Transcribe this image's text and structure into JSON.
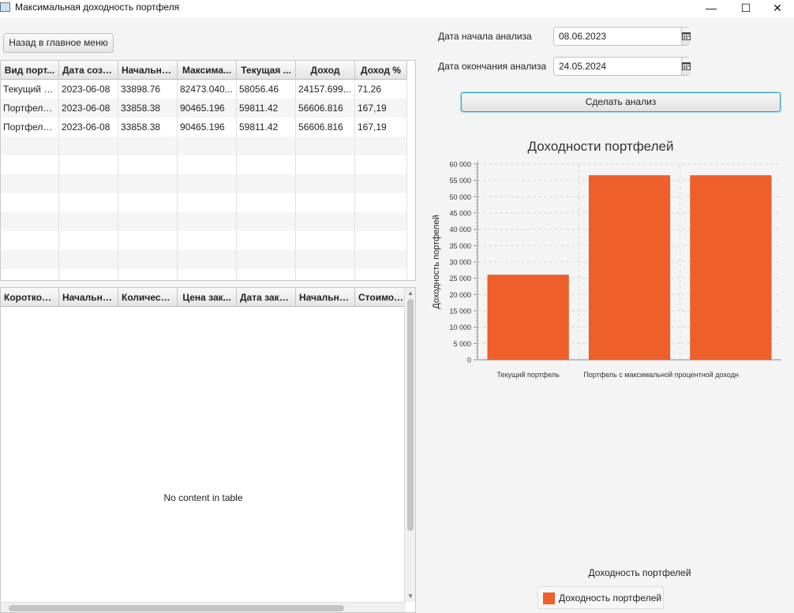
{
  "window": {
    "title": "Максимальная доходность портфеля",
    "minimize_label": "—",
    "maximize_label": "☐",
    "close_label": "✕"
  },
  "back_button_label": "Назад в главное меню",
  "portfolio_table": {
    "columns": [
      "Вид порт...",
      "Дата созд...",
      "Начально...",
      "Максима...",
      "Текущая ...",
      "Доход",
      "Доход %"
    ],
    "rows": [
      [
        "Текущий п...",
        "2023-06-08",
        "33898.76",
        "82473.040...",
        "58056.46",
        "24157.699...",
        "71,26"
      ],
      [
        "Портфель ...",
        "2023-06-08",
        "33858.38",
        "90465.196",
        "59811.42",
        "56606.816",
        "167,19"
      ],
      [
        "Портфель ...",
        "2023-06-08",
        "33858.38",
        "90465.196",
        "59811.42",
        "56606.816",
        "167,19"
      ]
    ]
  },
  "positions_table": {
    "columns": [
      "Короткое ...",
      "Начальна...",
      "Количество",
      "Цена зак...",
      "Дата закр...",
      "Начальна...",
      "Стоимост..."
    ],
    "empty_text": "No content in table"
  },
  "analysis": {
    "start_label": "Дата начала анализа",
    "start_value": "08.06.2023",
    "end_label": "Дата окончания анализа",
    "end_value": "24.05.2024",
    "run_button_label": "Сделать анализ"
  },
  "chart_data": {
    "type": "bar",
    "title": "Доходности портфелей",
    "ylabel": "Доходность портфелей",
    "xlabel": "Доходность портфелей",
    "ylim": [
      0,
      60000
    ],
    "yticks": [
      "0",
      "5 000",
      "10 000",
      "15 000",
      "20 000",
      "25 000",
      "30 000",
      "35 000",
      "40 000",
      "45 000",
      "50 000",
      "55 000",
      "60 000"
    ],
    "categories": [
      "Текущий портфель",
      "Портфель с максимальной процентной доходн",
      ""
    ],
    "series": [
      {
        "name": "Доходность портфелей",
        "values": [
          26000,
          56500,
          56500
        ]
      }
    ],
    "bar_color": "#ee5f2b",
    "grid": true,
    "legend_position": "bottom"
  }
}
